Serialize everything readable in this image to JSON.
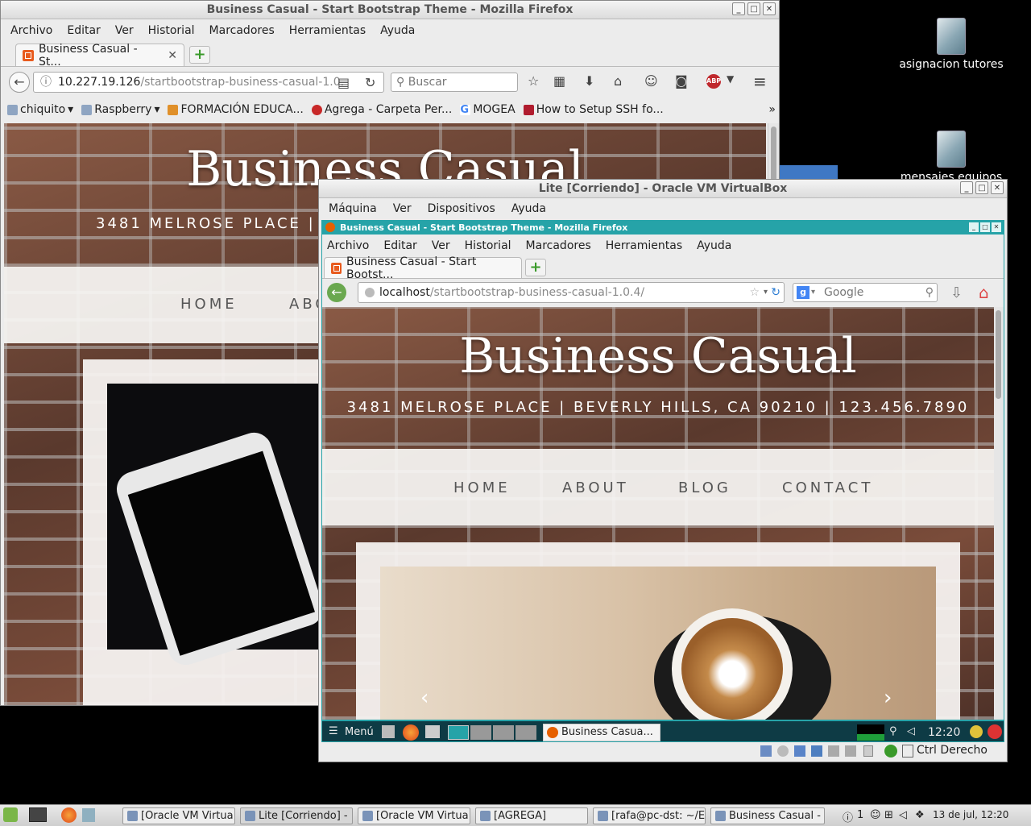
{
  "desktop": {
    "icons": [
      {
        "label": "asignacion tutores"
      },
      {
        "label": "mensajes equipos"
      }
    ]
  },
  "back_window": {
    "title": "Business Casual - Start Bootstrap Theme - Mozilla Firefox",
    "menu": [
      "Archivo",
      "Editar",
      "Ver",
      "Historial",
      "Marcadores",
      "Herramientas",
      "Ayuda"
    ],
    "tab_label": "Business Casual - St...",
    "url_host": "10.227.19.126",
    "url_path": "/startbootstrap-business-casual-1.0.",
    "search_placeholder": "Buscar",
    "bookmarks": [
      "chiquito",
      "Raspberry",
      "FORMACIÓN EDUCA...",
      "Agrega - Carpeta Per...",
      "MOGEA",
      "How to Setup SSH fo..."
    ],
    "page": {
      "title": "Business Casual",
      "address": "3481 MELROSE PLACE | B",
      "nav": [
        "HOME",
        "ABO"
      ]
    }
  },
  "vbox_window": {
    "title": "Lite [Corriendo] - Oracle VM VirtualBox",
    "menu": [
      "Máquina",
      "Ver",
      "Dispositivos",
      "Ayuda"
    ],
    "status_text": "Ctrl Derecho"
  },
  "guest_firefox": {
    "title": "Business Casual - Start Bootstrap Theme - Mozilla Firefox",
    "menu": [
      "Archivo",
      "Editar",
      "Ver",
      "Historial",
      "Marcadores",
      "Herramientas",
      "Ayuda"
    ],
    "tab_label": "Business Casual - Start Bootst...",
    "url_host": "localhost",
    "url_path": "/startbootstrap-business-casual-1.0.4/",
    "search_placeholder": "Google",
    "page": {
      "title": "Business Casual",
      "address": "3481 MELROSE PLACE | BEVERLY HILLS, CA 90210 | 123.456.7890",
      "nav": [
        "HOME",
        "ABOUT",
        "BLOG",
        "CONTACT"
      ],
      "carousel_prev": "‹",
      "carousel_next": "›"
    }
  },
  "guest_taskbar": {
    "menu_label": "Menú",
    "task_label": "Business Casua...",
    "clock": "12:20"
  },
  "host_taskbar": {
    "tasks": [
      "[Oracle VM Virtua...",
      "Lite [Corriendo] - ...",
      "[Oracle VM Virtua...",
      "[AGREGA]",
      "[rafa@pc-dst: ~/E...",
      "Business Casual - ..."
    ],
    "workspace": "1",
    "clock": "13 de jul, 12:20"
  },
  "colors": {
    "accent_teal": "#26a3a8",
    "guest_panel": "#0e3b45",
    "brick": "#6d4434"
  }
}
